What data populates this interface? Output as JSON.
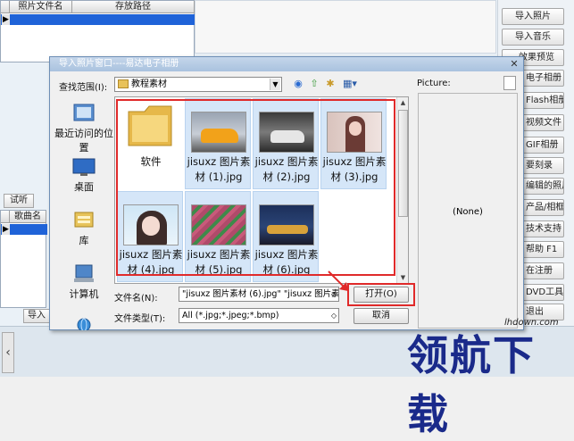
{
  "background": {
    "grid1": {
      "col1": "照片文件名",
      "col2": "存放路径"
    },
    "grid2": {
      "col1": "歌曲名"
    },
    "left_buttons": [
      "试听",
      "导入"
    ],
    "right_buttons": [
      "导入照片",
      "导入音乐",
      "效果预览",
      "电子相册",
      "Flash相册",
      "视频文件",
      "GIF相册",
      "要刻录",
      "编辑的照片",
      "产品/相框",
      "技术支持",
      "帮助 F1",
      "在注册",
      "DVD工具",
      "退出"
    ]
  },
  "dialog": {
    "title": "导入照片窗口----易达电子相册",
    "lookin_label": "查找范围(I):",
    "lookin_value": "教程素材",
    "places": [
      "最近访问的位置",
      "桌面",
      "库",
      "计算机",
      "网络"
    ],
    "files": [
      {
        "name": "软件",
        "kind": "folder",
        "selected": false
      },
      {
        "name": "jisuxz 图片素材 (1).jpg",
        "kind": "image",
        "selected": true
      },
      {
        "name": "jisuxz 图片素材 (2).jpg",
        "kind": "image",
        "selected": true
      },
      {
        "name": "jisuxz 图片素材 (3).jpg",
        "kind": "image",
        "selected": true
      },
      {
        "name": "jisuxz 图片素材 (4).jpg",
        "kind": "image",
        "selected": true
      },
      {
        "name": "jisuxz 图片素材 (5).jpg",
        "kind": "image",
        "selected": true
      },
      {
        "name": "jisuxz 图片素材 (6).jpg",
        "kind": "image",
        "selected": true
      }
    ],
    "filename_label": "文件名(N):",
    "filename_value": "\"jisuxz 图片素材 (6).jpg\" \"jisuxz 图片素",
    "filetype_label": "文件类型(T):",
    "filetype_value": "All (*.jpg;*.jpeg;*.bmp)",
    "open_button": "打开(O)",
    "cancel_button": "取消",
    "preview_label": "Picture:",
    "preview_value": "(None)"
  },
  "watermark": {
    "text": "领航下载",
    "url": "lhdown.com"
  }
}
